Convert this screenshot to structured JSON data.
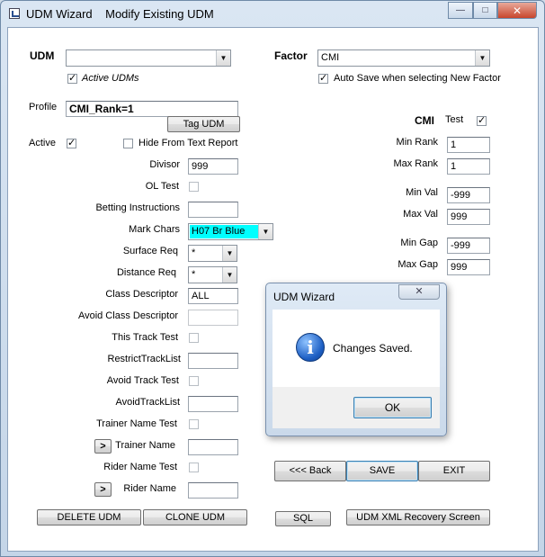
{
  "window": {
    "title": "UDM Wizard    Modify Existing UDM",
    "minimize": "—",
    "maximize": "□",
    "close": "✕"
  },
  "left": {
    "udm_label": "UDM",
    "udm_value": "",
    "active_udms_label": "Active UDMs",
    "active_udms_checked": "✓",
    "profile_label": "Profile",
    "profile_value": "CMI_Rank=1",
    "tag_udm_button": "Tag UDM",
    "active_label": "Active",
    "active_checked": "✓",
    "hide_label": "Hide From Text Report",
    "fields": {
      "divisor_label": "Divisor",
      "divisor_value": "999",
      "ol_test_label": "OL Test",
      "betting_label": "Betting Instructions",
      "betting_value": "",
      "mark_chars_label": "Mark Chars",
      "mark_chars_value": "H07 Br Blue",
      "surface_label": "Surface Req",
      "surface_value": "*",
      "distance_label": "Distance Req",
      "distance_value": "*",
      "class_desc_label": "Class Descriptor",
      "class_desc_value": "ALL",
      "avoid_class_label": "Avoid Class Descriptor",
      "avoid_class_value": "",
      "this_track_label": "This Track Test",
      "restrict_label": "RestrictTrackList",
      "restrict_value": "",
      "avoid_track_test_label": "Avoid Track Test",
      "avoid_track_list_label": "AvoidTrackList",
      "avoid_track_list_value": "",
      "trainer_test_label": "Trainer Name Test",
      "trainer_name_label": "Trainer Name",
      "trainer_name_value": "",
      "trainer_expand": ">",
      "rider_test_label": "Rider Name Test",
      "rider_name_label": "Rider Name",
      "rider_name_value": "",
      "rider_expand": ">"
    }
  },
  "right": {
    "factor_label": "Factor",
    "factor_value": "CMI",
    "auto_save_label": "Auto Save when selecting New Factor",
    "auto_save_checked": "✓",
    "cmi_label": "CMI",
    "test_label": "Test",
    "test_checked": "✓",
    "min_rank_label": "Min Rank",
    "min_rank_value": "1",
    "max_rank_label": "Max Rank",
    "max_rank_value": "1",
    "min_val_label": "Min Val",
    "min_val_value": "-999",
    "max_val_label": "Max Val",
    "max_val_value": "999",
    "min_gap_label": "Min Gap",
    "min_gap_value": "-999",
    "max_gap_label": "Max Gap",
    "max_gap_value": "999"
  },
  "buttons": {
    "back": "<<< Back",
    "save": "SAVE",
    "exit": "EXIT",
    "delete": "DELETE UDM",
    "clone": "CLONE UDM",
    "sql": "SQL",
    "xml_recovery": "UDM XML Recovery Screen"
  },
  "dialog": {
    "title": "UDM Wizard",
    "close": "✕",
    "message": "Changes Saved.",
    "icon": "i",
    "ok": "OK"
  },
  "colors": {
    "mark_chars_highlight": "#00ffff"
  }
}
